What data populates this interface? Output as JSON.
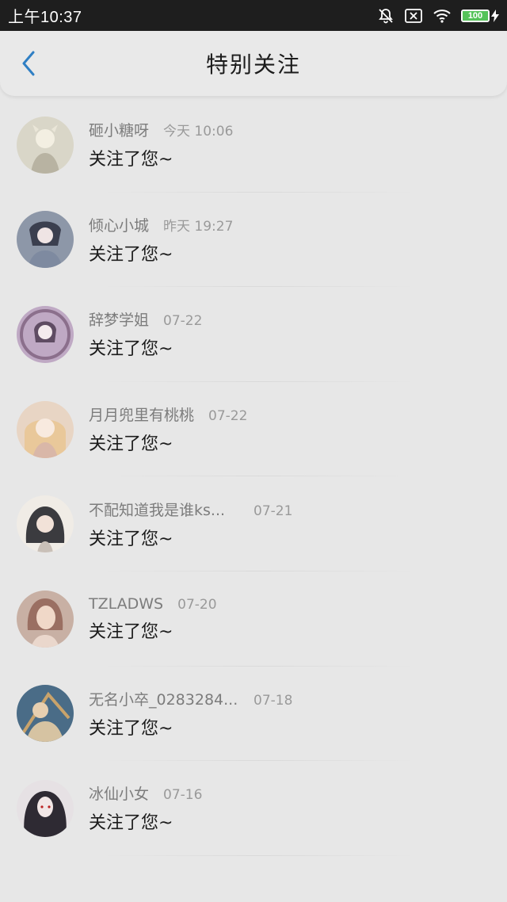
{
  "status_bar": {
    "time": "上午10:37",
    "battery": "100",
    "battery_level": 1.0
  },
  "header": {
    "title": "特别关注"
  },
  "items": [
    {
      "name": "砸小糖呀",
      "time": "今天 10:06",
      "message": "关注了您~",
      "avatar_color": "#d9d6c8"
    },
    {
      "name": "倾心小城",
      "time": "昨天 19:27",
      "message": "关注了您~",
      "avatar_color": "#8d97a8"
    },
    {
      "name": "辞梦学姐",
      "time": "07-22",
      "message": "关注了您~",
      "avatar_color": "#bfa9c4"
    },
    {
      "name": "月月兜里有桃桃",
      "time": "07-22",
      "message": "关注了您~",
      "avatar_color": "#e8d5c4"
    },
    {
      "name": "不配知道我是谁ks...",
      "time": "07-21",
      "message": "关注了您~",
      "avatar_color": "#3b3b3f"
    },
    {
      "name": "TZLADWS",
      "time": "07-20",
      "message": "关注了您~",
      "avatar_color": "#9a6f62"
    },
    {
      "name": "无名小卒_0283284...",
      "time": "07-18",
      "message": "关注了您~",
      "avatar_color": "#4a6c87"
    },
    {
      "name": "冰仙小女",
      "time": "07-16",
      "message": "关注了您~",
      "avatar_color": "#2e2a33"
    }
  ]
}
